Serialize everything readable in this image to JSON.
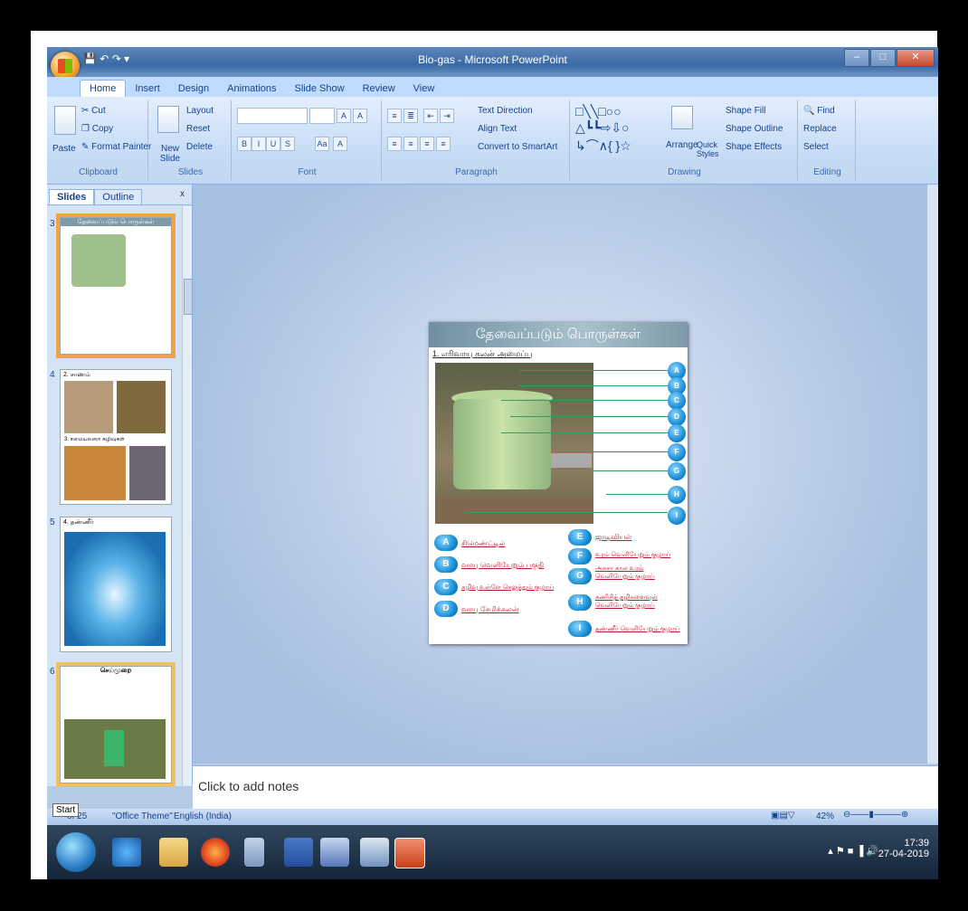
{
  "window": {
    "title": "Bio-gas - Microsoft PowerPoint",
    "qat": "▾"
  },
  "tabs": [
    "Home",
    "Insert",
    "Design",
    "Animations",
    "Slide Show",
    "Review",
    "View"
  ],
  "ribbon": {
    "clipboard": {
      "paste": "Paste",
      "cut": "Cut",
      "copy": "Copy",
      "format_painter": "Format Painter",
      "label": "Clipboard"
    },
    "slides": {
      "new_slide": "New Slide",
      "layout": "Layout",
      "reset": "Reset",
      "delete": "Delete",
      "label": "Slides"
    },
    "font": {
      "label": "Font"
    },
    "paragraph": {
      "text_direction": "Text Direction",
      "align_text": "Align Text",
      "convert": "Convert to SmartArt",
      "label": "Paragraph"
    },
    "drawing": {
      "arrange": "Arrange",
      "quick_styles": "Quick Styles",
      "shape_fill": "Shape Fill",
      "shape_outline": "Shape Outline",
      "shape_effects": "Shape Effects",
      "label": "Drawing"
    },
    "editing": {
      "find": "Find",
      "replace": "Replace",
      "select": "Select",
      "label": "Editing"
    }
  },
  "pane": {
    "tabs": [
      "Slides",
      "Outline"
    ],
    "close": "x"
  },
  "thumbnails": [
    {
      "num": "3",
      "caption": "தேவைப்படும் பொருள்கள்"
    },
    {
      "num": "4",
      "caption": "2. சாணம்",
      "caption2": "3. சமையலறை கழிவுகள்"
    },
    {
      "num": "5",
      "caption": "4. தண்ணீர்"
    },
    {
      "num": "6",
      "caption": "செய்முறை"
    }
  ],
  "slide": {
    "title": "தேவைப்படும் பொருள்கள்",
    "subtitle": "1. எரிவாயு கலன் அமைப்பு",
    "markers": [
      "A",
      "B",
      "C",
      "D",
      "E",
      "F",
      "G",
      "H",
      "I"
    ],
    "legend_left": [
      {
        "k": "A",
        "t": "சிமெண்ட்டில்"
      },
      {
        "k": "B",
        "t": "வாயு வெளியேறும் பகுதி"
      },
      {
        "k": "C",
        "t": "கழிவு உள்ளே செலுத்தும் குழாய்"
      },
      {
        "k": "D",
        "t": "வாயு சேமிக்கலன்"
      }
    ],
    "legend_right": [
      {
        "k": "E",
        "t": "ஜாடிவியள்"
      },
      {
        "k": "F",
        "t": "உரம் வெளியேறும் குழாய்"
      },
      {
        "k": "G",
        "t": "அசுசா கால உரம் வெளியேறும் குழாய்"
      },
      {
        "k": "H",
        "t": "கணிசித் தழிகளைவுள் வெளியேறும் குழாய்"
      },
      {
        "k": "I",
        "t": "தண்ணீர் வெளியேறும் குழாய்"
      }
    ]
  },
  "notes": "Click to add notes",
  "status": {
    "slide": "of 25",
    "theme": "\"Office Theme\"",
    "language": "English (India)",
    "zoom": "42%",
    "start_tip": "Start"
  },
  "taskbar": {
    "time": "17:39",
    "date": "27-04-2019"
  }
}
